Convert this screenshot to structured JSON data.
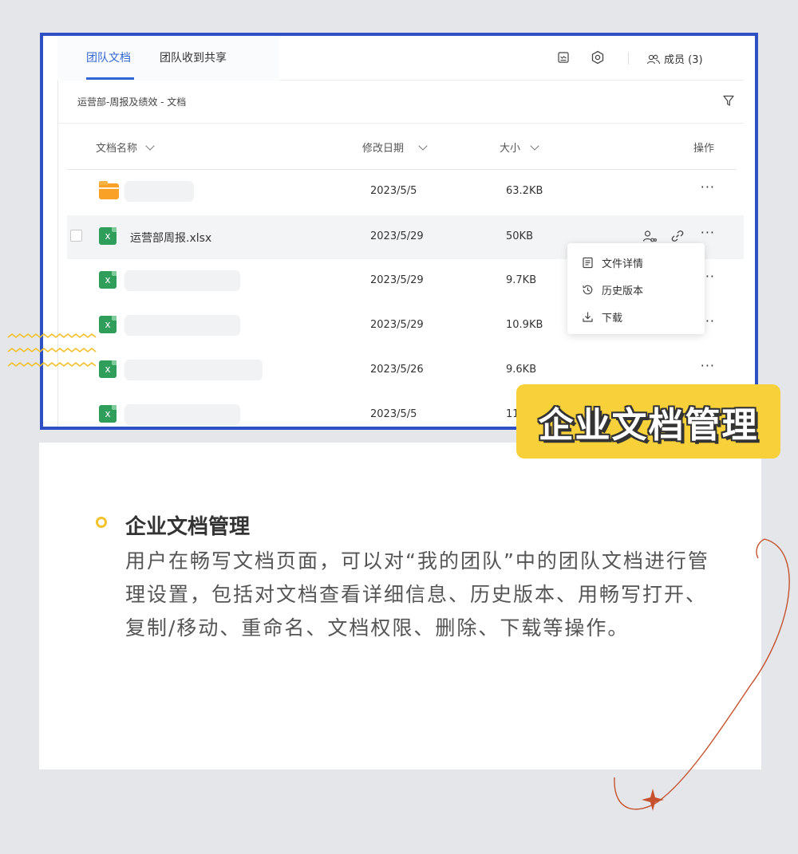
{
  "tabs": [
    {
      "label": "团队文档",
      "active": true
    },
    {
      "label": "团队收到共享",
      "active": false
    }
  ],
  "toolbar": {
    "icons": [
      "summary-icon",
      "settings-icon"
    ],
    "members_label": "成员 (3)"
  },
  "breadcrumb": "运营部-周报及绩效 - 文档",
  "table": {
    "columns": {
      "name": "文档名称",
      "modified": "修改日期",
      "size": "大小",
      "actions": "操作"
    },
    "rows": [
      {
        "type": "folder",
        "name": "",
        "date": "2023/5/5",
        "size": "63.2KB"
      },
      {
        "type": "xlsx",
        "name": "运营部周报.xlsx",
        "date": "2023/5/29",
        "size": "50KB",
        "hover": true
      },
      {
        "type": "xlsx",
        "name": "",
        "date": "2023/5/29",
        "size": "9.7KB"
      },
      {
        "type": "xlsx",
        "name": "",
        "date": "2023/5/29",
        "size": "10.9KB"
      },
      {
        "type": "xlsx",
        "name": "",
        "date": "2023/5/26",
        "size": "9.6KB"
      },
      {
        "type": "xlsx",
        "name": "",
        "date": "2023/5/5",
        "size": "11"
      }
    ],
    "more_label": "···"
  },
  "context_menu": [
    {
      "label": "文件详情",
      "icon": "document-icon"
    },
    {
      "label": "历史版本",
      "icon": "history-icon"
    },
    {
      "label": "下载",
      "icon": "download-icon"
    }
  ],
  "badge": "企业文档管理",
  "card": {
    "title": "企业文档管理",
    "body": "用户在畅写文档页面，可以对“我的团队”中的团队文档进行管理设置，包括对文档查看详细信息、历史版本、用畅写打开、复制/移动、重命名、文档权限、删除、下载等操作。"
  },
  "colors": {
    "accent": "#3266d6",
    "frame": "#2f4fc4",
    "badge": "#f8d13a",
    "bullet": "#f4c22b",
    "excel": "#2f9e5a",
    "folder": "#f8a126",
    "deco": "#c5522d"
  }
}
